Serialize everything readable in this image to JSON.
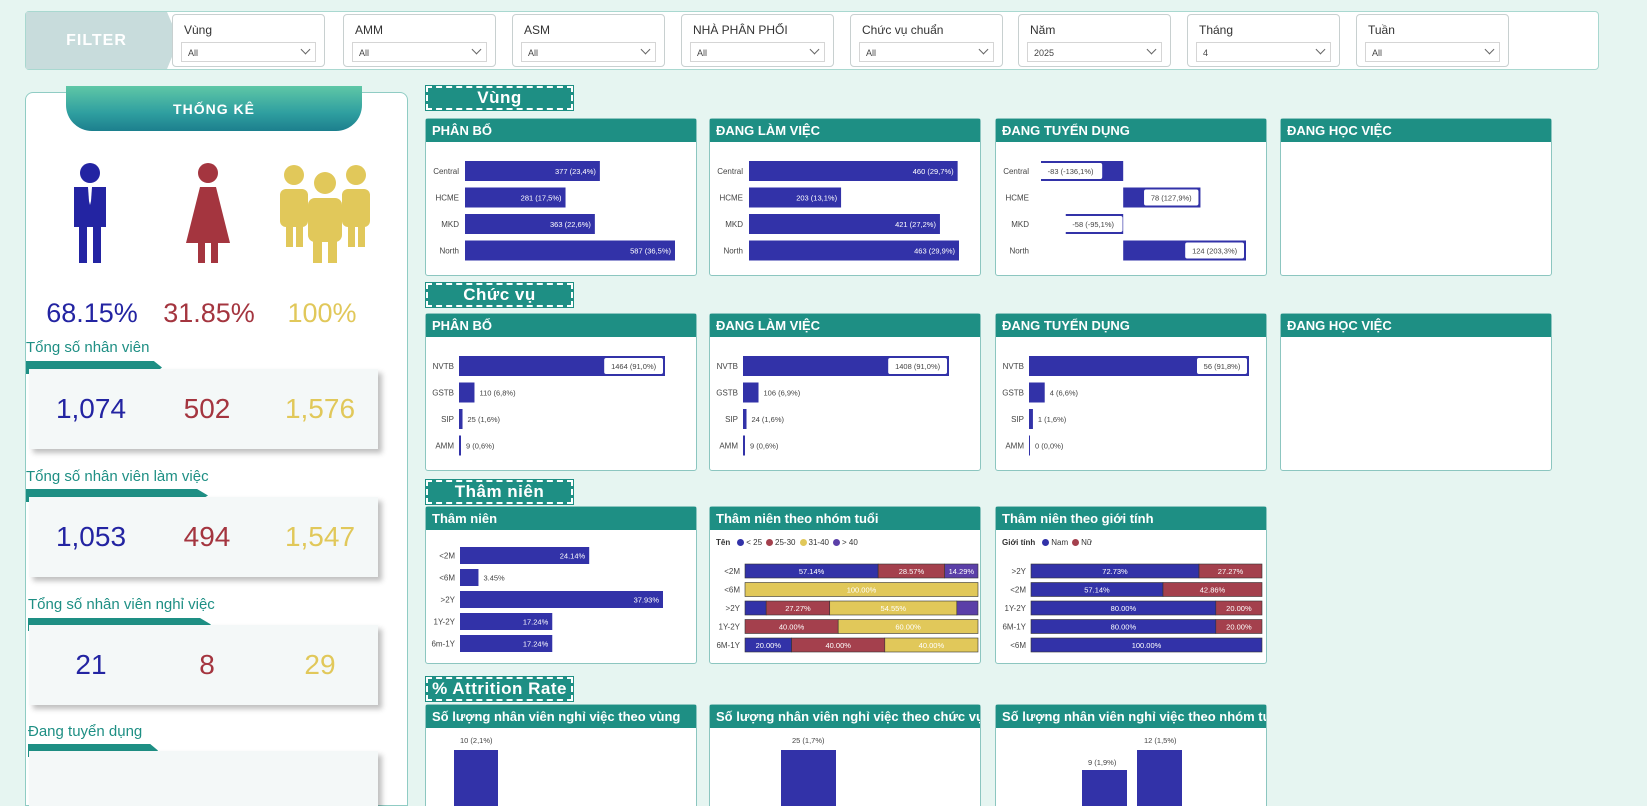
{
  "filters": {
    "tag": "FILTER",
    "slicers": [
      {
        "label": "Vùng",
        "value": "All"
      },
      {
        "label": "AMM",
        "value": "All"
      },
      {
        "label": "ASM",
        "value": "All"
      },
      {
        "label": "NHÀ PHÂN PHỐI",
        "value": "All"
      },
      {
        "label": "Chức vụ chuẩn",
        "value": "All"
      },
      {
        "label": "Năm",
        "value": "2025"
      },
      {
        "label": "Tháng",
        "value": "4"
      },
      {
        "label": "Tuần",
        "value": "All"
      }
    ]
  },
  "stats": {
    "title": "THỐNG KÊ",
    "icons": [
      "male-icon",
      "female-icon",
      "group-icon"
    ],
    "percents": [
      "68.15%",
      "31.85%",
      "100%"
    ],
    "colors": {
      "male": "#2324a2",
      "female": "#a4353f",
      "total": "#e1c85a",
      "teal": "#1e8f84",
      "bar": "#3232a8"
    },
    "total": {
      "label": "Tổng số nhân viên",
      "male": "1,074",
      "female": "502",
      "all": "1,576"
    },
    "working": {
      "label": "Tổng số nhân viên làm việc",
      "male": "1,053",
      "female": "494",
      "all": "1,547"
    },
    "quit": {
      "label": "Tổng số nhân viên nghỉ việc",
      "male": "21",
      "female": "8",
      "all": "29"
    },
    "recruiting": {
      "label": "Đang tuyển dụng"
    }
  },
  "sections": {
    "region": "Vùng",
    "position": "Chức vụ",
    "seniority": "Thâm niên",
    "attrition": "% Attrition Rate"
  },
  "panels": {
    "region": [
      "PHÂN BỔ",
      "ĐANG LÀM VIỆC",
      "ĐANG TUYỂN DỤNG",
      "ĐANG HỌC VIỆC"
    ],
    "position": [
      "PHÂN BỔ",
      "ĐANG LÀM VIỆC",
      "ĐANG TUYỂN DỤNG",
      "ĐANG HỌC VIỆC"
    ],
    "seniority": [
      "Thâm niên",
      "Thâm niên theo nhóm tuổi",
      "Thâm niên theo giới tính"
    ],
    "attrition": [
      "Số lượng nhân viên nghỉ việc theo vùng",
      "Số lượng nhân viên nghỉ việc theo chức vụ",
      "Số lượng nhân viên nghỉ việc theo nhóm tuổi"
    ]
  },
  "legends": {
    "age": {
      "title": "Tên",
      "items": [
        "< 25",
        "25-30",
        "31-40",
        "> 40"
      ],
      "colors": [
        "#3232a8",
        "#a4404d",
        "#e1c85a",
        "#5b3fa8"
      ]
    },
    "gender": {
      "title": "Giới tính",
      "items": [
        "Nam",
        "Nữ"
      ],
      "colors": [
        "#3232a8",
        "#a4404d"
      ]
    }
  },
  "chart_data": [
    {
      "type": "bar",
      "title": "PHÂN BỔ",
      "categories": [
        "Central",
        "HCME",
        "MKD",
        "North"
      ],
      "values": [
        377,
        281,
        363,
        587
      ],
      "labels": [
        "377 (23,4%)",
        "281 (17,5%)",
        "363 (22,6%)",
        "587 (36,5%)"
      ]
    },
    {
      "type": "bar",
      "title": "ĐANG LÀM VIỆC",
      "categories": [
        "Central",
        "HCME",
        "MKD",
        "North"
      ],
      "values": [
        460,
        203,
        421,
        463
      ],
      "labels": [
        "460 (29,7%)",
        "203 (13,1%)",
        "421 (27,2%)",
        "463 (29,9%)"
      ]
    },
    {
      "type": "bar",
      "title": "ĐANG TUYỂN DỤNG",
      "categories": [
        "Central",
        "HCME",
        "MKD",
        "North"
      ],
      "values": [
        -83,
        78,
        -58,
        124
      ],
      "labels": [
        "-83 (-136,1%)",
        "78 (127,9%)",
        "-58 (-95,1%)",
        "124 (203,3%)"
      ]
    },
    {
      "type": "bar",
      "title": "PHÂN BỔ",
      "categories": [
        "NVTB",
        "GSTB",
        "SIP",
        "AMM"
      ],
      "values": [
        1464,
        110,
        25,
        9
      ],
      "labels": [
        "1464 (91,0%)",
        "110 (6,8%)",
        "25 (1,6%)",
        "9 (0,6%)"
      ]
    },
    {
      "type": "bar",
      "title": "ĐANG LÀM VIỆC",
      "categories": [
        "NVTB",
        "GSTB",
        "SIP",
        "AMM"
      ],
      "values": [
        1408,
        106,
        24,
        9
      ],
      "labels": [
        "1408 (91,0%)",
        "106 (6,9%)",
        "24 (1,6%)",
        "9 (0,6%)"
      ]
    },
    {
      "type": "bar",
      "title": "ĐANG TUYỂN DỤNG",
      "categories": [
        "NVTB",
        "GSTB",
        "SIP",
        "AMM"
      ],
      "values": [
        56,
        4,
        1,
        0
      ],
      "labels": [
        "56 (91,8%)",
        "4 (6,6%)",
        "1 (1,6%)",
        "0 (0,0%)"
      ]
    },
    {
      "type": "bar",
      "title": "Thâm niên",
      "categories": [
        "<2M",
        "<6M",
        ">2Y",
        "1Y-2Y",
        "6m-1Y"
      ],
      "values": [
        24.14,
        3.45,
        37.93,
        17.24,
        17.24
      ],
      "labels": [
        "24.14%",
        "3.45%",
        "37.93%",
        "17.24%",
        "17.24%"
      ]
    },
    {
      "type": "bar",
      "title": "Thâm niên theo nhóm tuổi",
      "stacked": true,
      "categories": [
        "<2M",
        "<6M",
        ">2Y",
        "1Y-2Y",
        "6M-1Y"
      ],
      "series": [
        {
          "name": "< 25",
          "values": [
            57.14,
            0,
            9.09,
            0,
            20.0
          ]
        },
        {
          "name": "25-30",
          "values": [
            28.57,
            0,
            27.27,
            40.0,
            40.0
          ]
        },
        {
          "name": "31-40",
          "values": [
            0,
            100.0,
            54.55,
            60.0,
            40.0
          ]
        },
        {
          "name": "> 40",
          "values": [
            14.29,
            0,
            9.09,
            0,
            0
          ]
        }
      ]
    },
    {
      "type": "bar",
      "title": "Thâm niên theo giới tính",
      "stacked": true,
      "categories": [
        ">2Y",
        "<2M",
        "1Y-2Y",
        "6M-1Y",
        "<6M"
      ],
      "series": [
        {
          "name": "Nam",
          "values": [
            72.73,
            57.14,
            80.0,
            80.0,
            100.0
          ]
        },
        {
          "name": "Nữ",
          "values": [
            27.27,
            42.86,
            20.0,
            20.0,
            0
          ]
        }
      ]
    },
    {
      "type": "bar",
      "title": "Số lượng nhân viên nghỉ việc theo vùng",
      "values": [
        10
      ],
      "labels": [
        "10 (2,1%)"
      ]
    },
    {
      "type": "bar",
      "title": "Số lượng nhân viên nghỉ việc theo chức vụ",
      "values": [
        25
      ],
      "labels": [
        "25 (1,7%)"
      ]
    },
    {
      "type": "bar",
      "title": "Số lượng nhân viên nghỉ việc theo nhóm tuổi",
      "values": [
        12,
        9
      ],
      "labels": [
        "12 (1,5%)",
        "9 (1,9%)"
      ]
    }
  ]
}
